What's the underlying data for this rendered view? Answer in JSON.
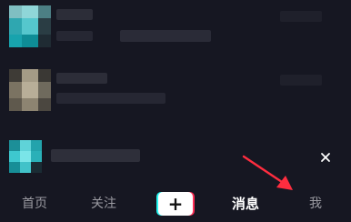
{
  "tabbar": {
    "items": [
      {
        "label": "首页"
      },
      {
        "label": "关注"
      },
      {
        "label": "消息"
      },
      {
        "label": "我"
      }
    ],
    "active_label": "消息",
    "plus_label": "+"
  },
  "messages": {
    "close_glyph": "×"
  },
  "annotation": {
    "arrow_color": "#ff2d3f"
  },
  "icons": {
    "close": "close-icon",
    "plus": "plus-icon",
    "arrow": "red-arrow-annotation"
  }
}
